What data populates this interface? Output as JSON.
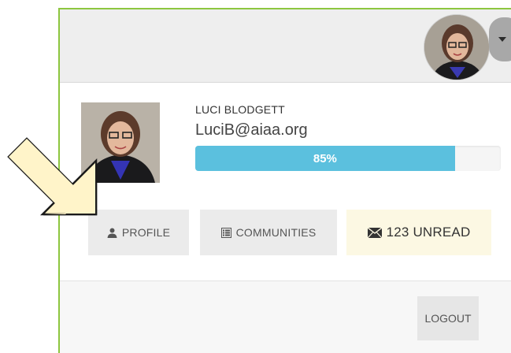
{
  "user": {
    "name": "LUCI BLODGETT",
    "email": "LuciB@aiaa.org",
    "progress_label": "85%",
    "progress_fraction": 0.85
  },
  "actions": {
    "profile_label": "PROFILE",
    "communities_label": "COMMUNITIES",
    "unread_label": "123 UNREAD",
    "logout_label": "LOGOUT"
  },
  "icons": {
    "profile": "user-icon",
    "communities": "list-icon",
    "unread": "envelope-icon",
    "menu": "caret-down-icon"
  },
  "colors": {
    "panel_border": "#8dc63f",
    "progress_fill": "#5bc0de",
    "unread_bg": "#fcf8e3",
    "arrow_fill": "#fff4c9"
  }
}
